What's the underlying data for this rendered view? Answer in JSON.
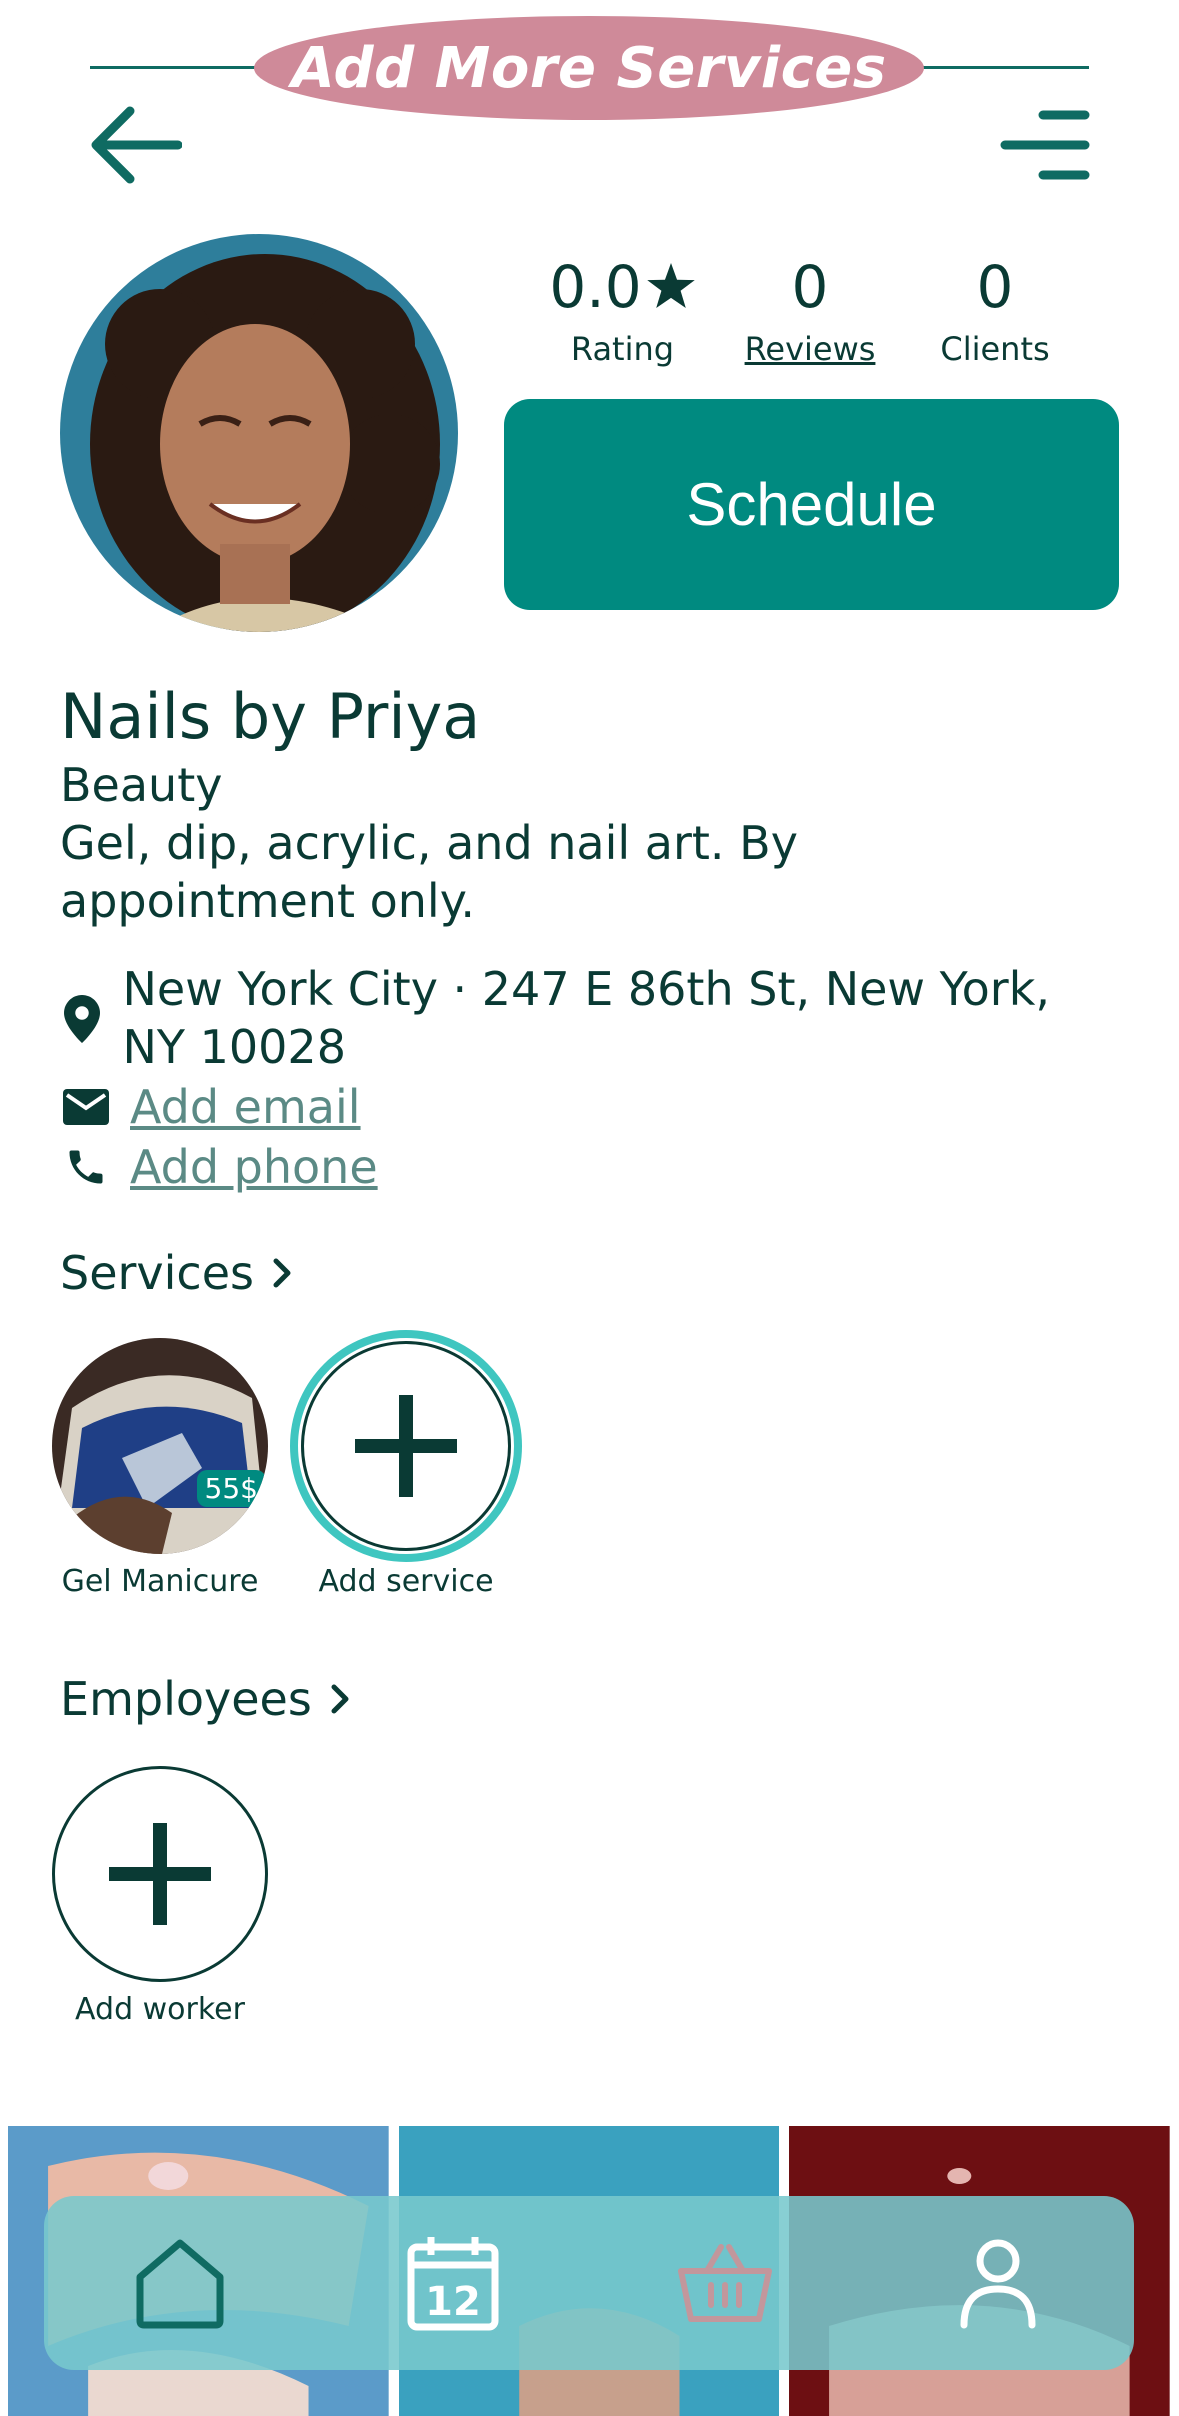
{
  "banner": {
    "text": "Add More Services"
  },
  "stats": {
    "rating": {
      "value": "0.0",
      "label": "Rating"
    },
    "reviews": {
      "value": "0",
      "label": "Reviews"
    },
    "clients": {
      "value": "0",
      "label": "Clients"
    }
  },
  "schedule_label": "Schedule",
  "business": {
    "name": "Nails by Priya",
    "category": "Beauty",
    "description": "Gel, dip, acrylic, and nail art. By appointment only.",
    "address": "New York City · 247 E 86th St, New York, NY 10028",
    "email_link": "Add email",
    "phone_link": "Add phone"
  },
  "services": {
    "title": "Services",
    "items": [
      {
        "name": "Gel Manicure",
        "price": "55$"
      }
    ],
    "add_label": "Add service"
  },
  "employees": {
    "title": "Employees",
    "add_label": "Add worker"
  },
  "bottom_nav": {
    "items": [
      {
        "icon": "home-icon"
      },
      {
        "icon": "calendar-icon",
        "text": "12"
      },
      {
        "icon": "basket-icon"
      },
      {
        "icon": "profile-icon"
      }
    ]
  },
  "colors": {
    "primary": "#008a80",
    "dark_text": "#0a3a34",
    "banner_pill": "#cf8a99",
    "nav_bg": "#78c8cd",
    "link": "#5b8a85",
    "glow": "#3fc6c0"
  }
}
